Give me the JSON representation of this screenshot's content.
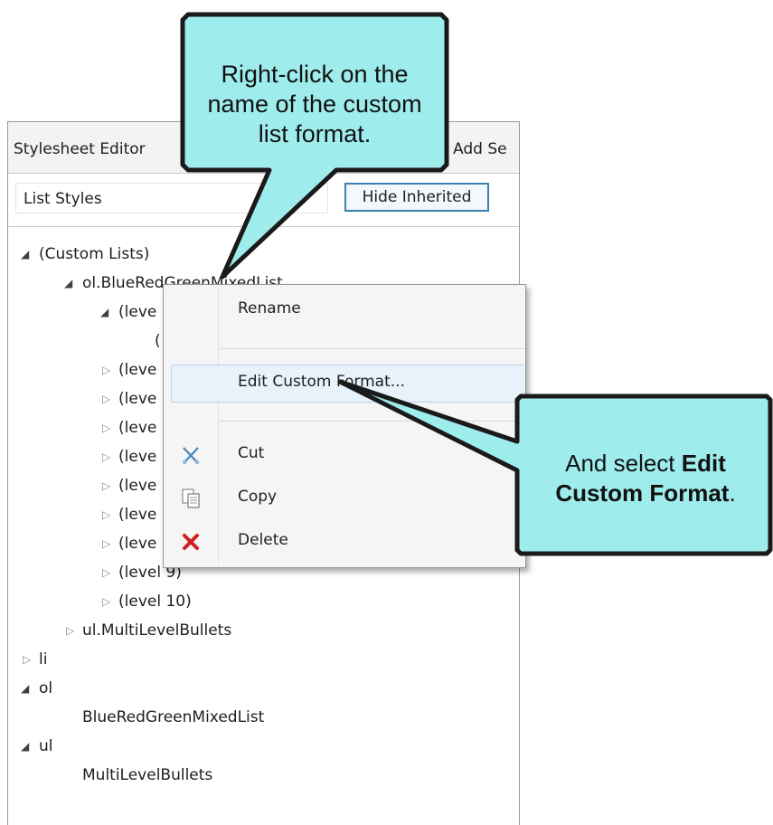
{
  "window": {
    "title": "Stylesheet Editor",
    "add_label": "Add Se"
  },
  "filter": {
    "combo_value": "List Styles",
    "hide_inherited_label": "Hide Inherited"
  },
  "tree": {
    "custom_lists": "(Custom Lists)",
    "blue_list": "ol.BlueRedGreenMixedList",
    "level1": "(leve",
    "level1_child": "(",
    "level2": "(leve",
    "level3": "(leve",
    "level4": "(leve",
    "level5": "(leve",
    "level6": "(leve",
    "level7": "(leve",
    "level8": "(leve",
    "level9": "(level 9)",
    "level10": "(level 10)",
    "multilevel": "ul.MultiLevelBullets",
    "li": "li",
    "ol": "ol",
    "ol_child": "BlueRedGreenMixedList",
    "ul": "ul",
    "ul_child": "MultiLevelBullets"
  },
  "context_menu": {
    "rename": "Rename",
    "edit_custom_format": "Edit Custom Format...",
    "cut": "Cut",
    "copy": "Copy",
    "delete": "Delete"
  },
  "callouts": {
    "top_text": "Right-click on the name of the custom list format.",
    "right_text_prefix": "And select ",
    "right_text_bold": "Edit Custom Format",
    "right_text_suffix": ".",
    "fill_color": "#9feced",
    "border_color": "#1a1a1a"
  },
  "icons": {
    "expanded": "expanded-triangle-icon",
    "collapsed": "collapsed-triangle-icon",
    "cut": "scissors-icon",
    "copy": "copy-icon",
    "delete": "red-x-icon"
  }
}
